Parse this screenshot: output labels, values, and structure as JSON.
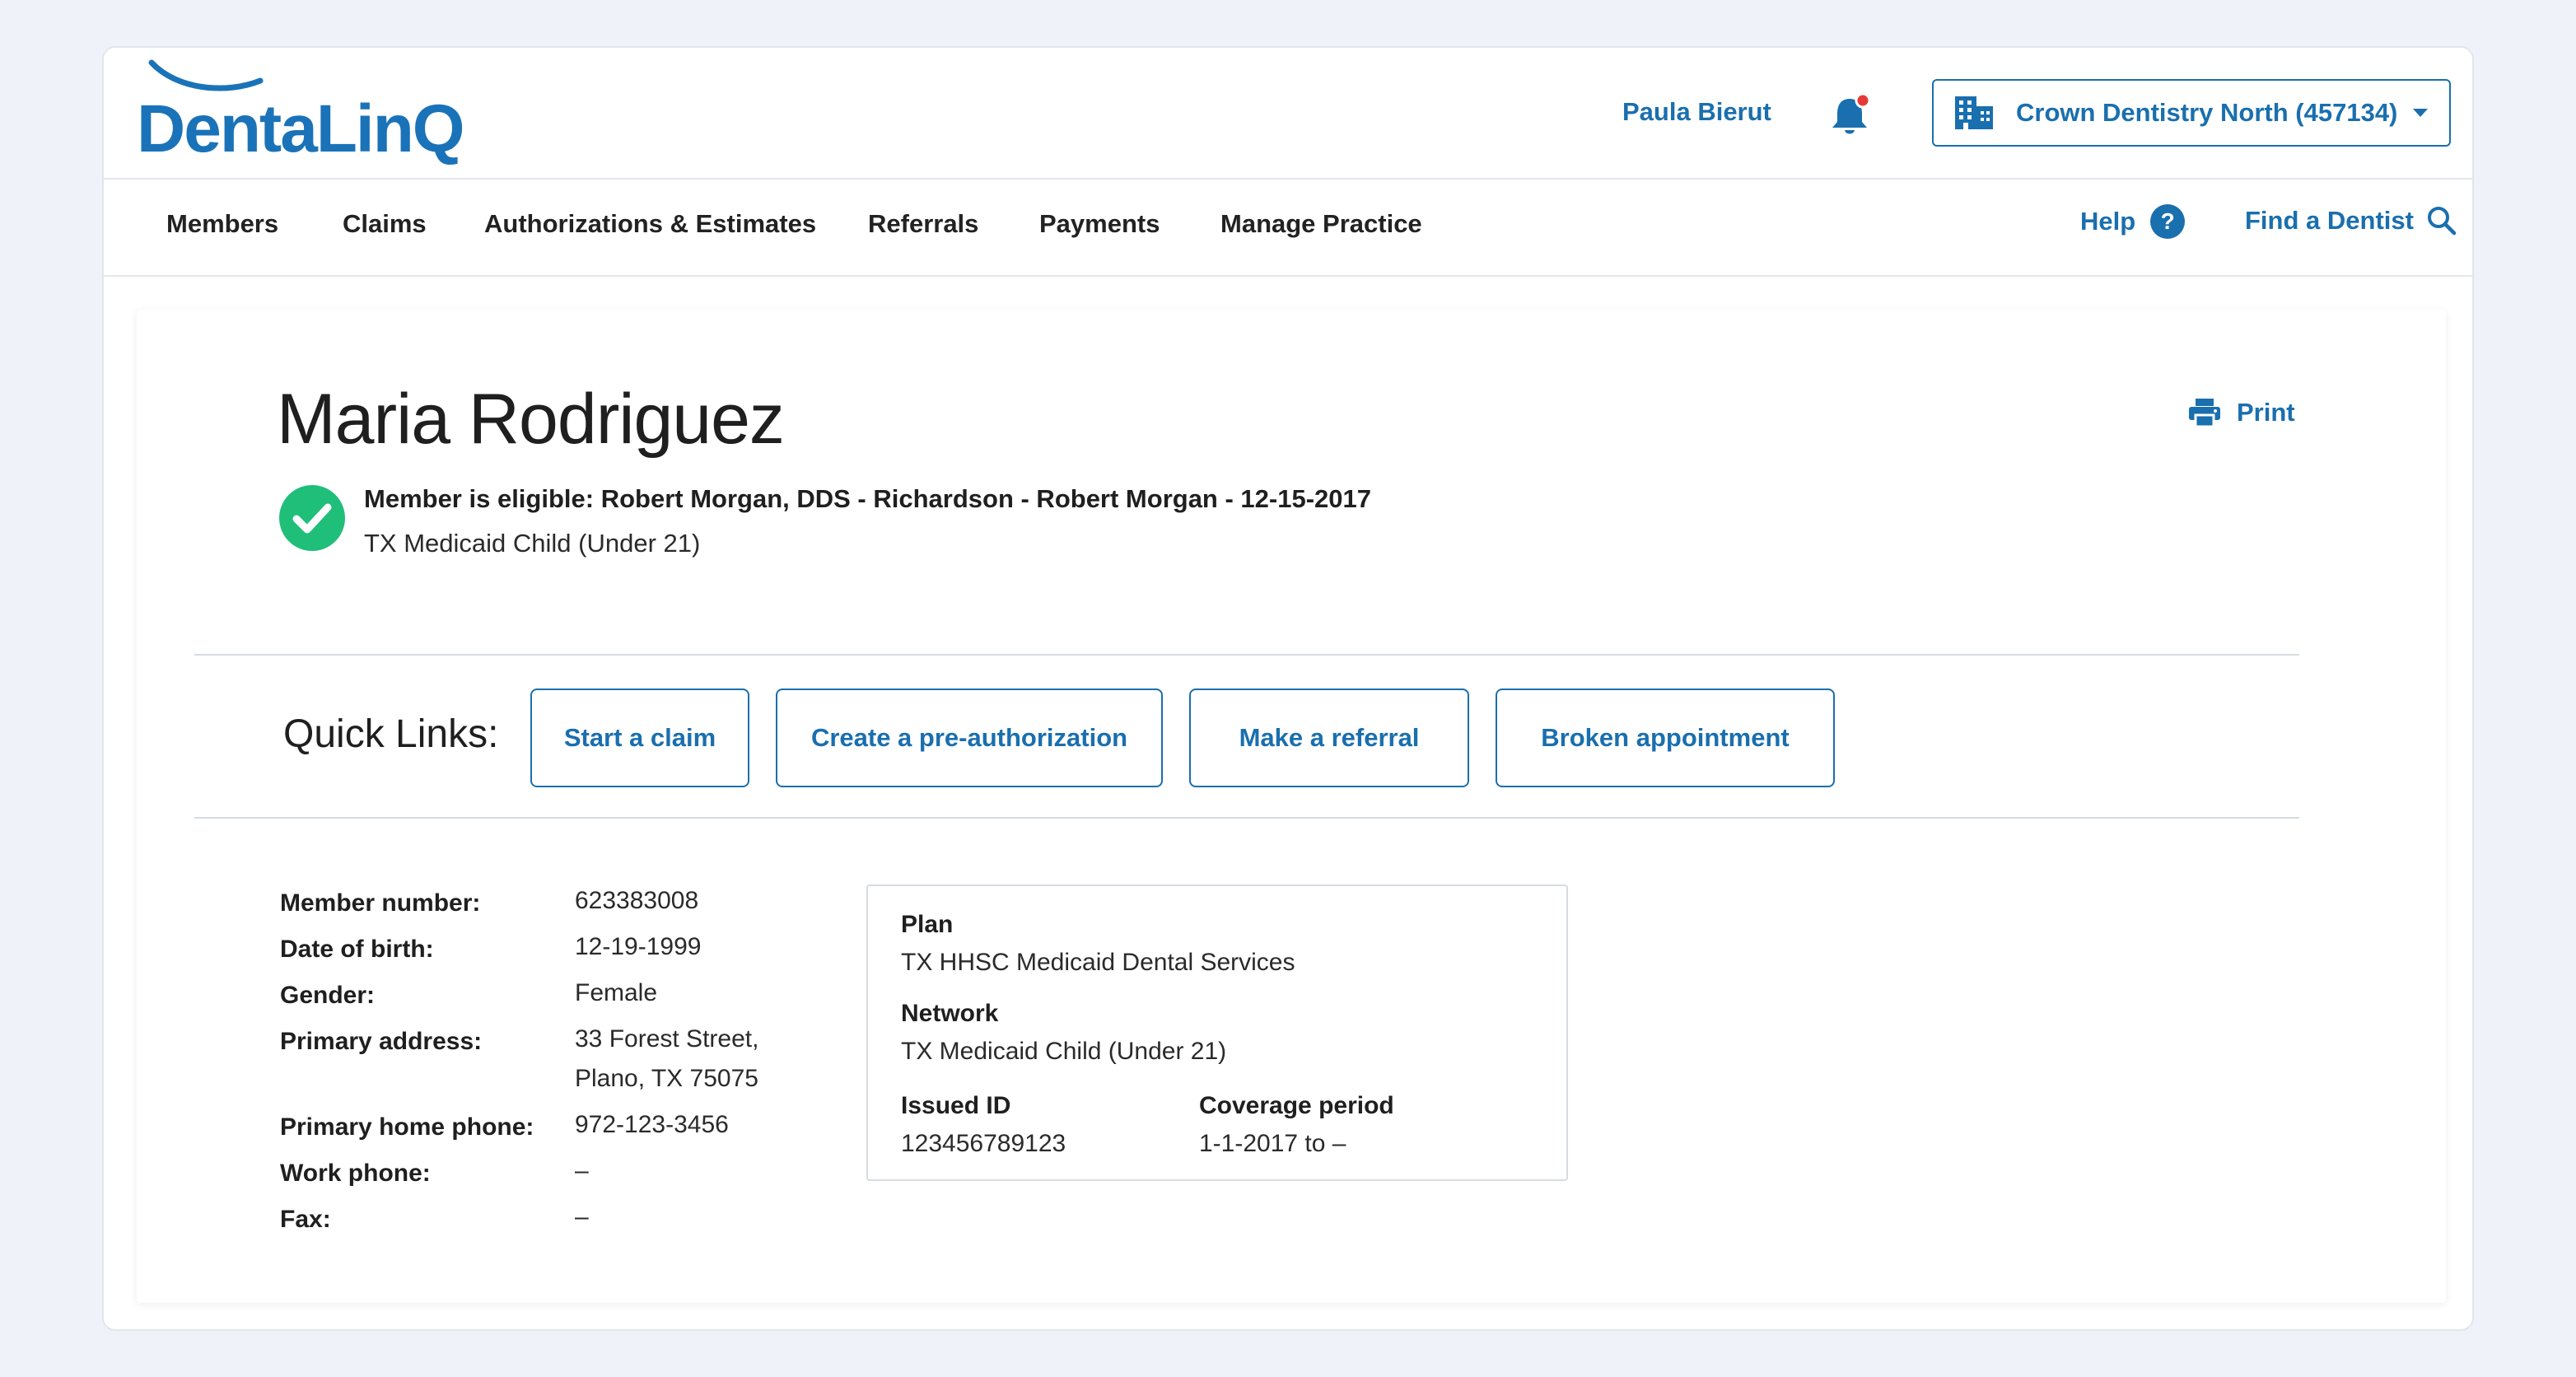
{
  "brand": {
    "logo_text": "DentaLinQ",
    "accent": "#1a6fae",
    "success": "#1fbf7a"
  },
  "header": {
    "user_name": "Paula Bierut",
    "practice": "Crown Dentistry North (457134)"
  },
  "nav": {
    "items": [
      "Members",
      "Claims",
      "Authorizations & Estimates",
      "Referrals",
      "Payments",
      "Manage Practice"
    ],
    "help_label": "Help",
    "help_glyph": "?",
    "find_label": "Find a Dentist"
  },
  "member": {
    "name": "Maria Rodriguez",
    "print_label": "Print",
    "eligibility": "Member is eligible: Robert Morgan, DDS - Richardson - Robert Morgan - 12-15-2017",
    "program": "TX Medicaid Child (Under 21)"
  },
  "quick_links": {
    "title": "Quick Links:",
    "buttons": [
      "Start a claim",
      "Create a pre-authorization",
      "Make a referral",
      "Broken appointment"
    ]
  },
  "details": {
    "member_number": {
      "label": "Member number:",
      "value": "623383008"
    },
    "dob": {
      "label": "Date of birth:",
      "value": "12-19-1999"
    },
    "gender": {
      "label": "Gender:",
      "value": "Female"
    },
    "address": {
      "label": "Primary address:",
      "line1": "33 Forest Street,",
      "line2": "Plano, TX 75075"
    },
    "home_phone": {
      "label": "Primary home phone:",
      "value": "972-123-3456"
    },
    "work_phone": {
      "label": "Work phone:",
      "value": "–"
    },
    "fax": {
      "label": "Fax:",
      "value": "–"
    }
  },
  "plan": {
    "plan_label": "Plan",
    "plan_value": "TX HHSC Medicaid Dental Services",
    "network_label": "Network",
    "network_value": "TX Medicaid Child (Under 21)",
    "issued_label": "Issued ID",
    "issued_value": "123456789123",
    "coverage_label": "Coverage period",
    "coverage_value": "1-1-2017 to –"
  }
}
